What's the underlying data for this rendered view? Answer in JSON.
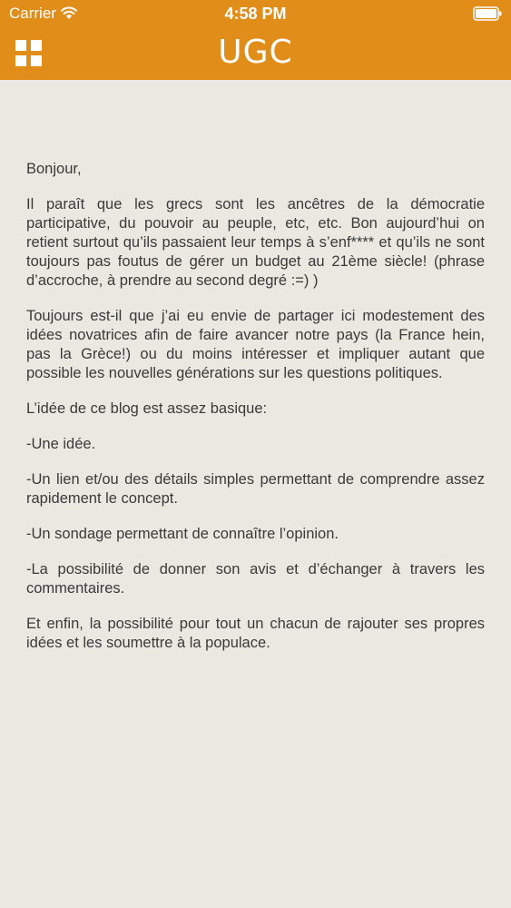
{
  "status_bar": {
    "carrier": "Carrier",
    "time": "4:58 PM",
    "wifi_icon": "wifi-icon",
    "battery_icon": "battery-icon"
  },
  "navbar": {
    "title": "UGC",
    "menu_icon": "grid-menu-icon",
    "color": "#e08d19"
  },
  "article": {
    "paragraphs": [
      "Bonjour,",
      "Il paraît que les grecs sont les ancêtres de la démocratie participative, du pouvoir au peuple, etc, etc. Bon aujourd’hui on retient surtout qu’ils passaient leur temps à s’enf**** et qu’ils ne sont toujours pas foutus de gérer un budget au 21ème siècle! (phrase d’accroche, à prendre au second degré :=) )",
      "Toujours est-il que j’ai eu envie de partager ici modestement des idées novatrices afin de faire avancer notre pays (la France hein, pas la Grèce!) ou du moins intéresser et impliquer autant que possible les nouvelles générations sur les questions politiques.",
      "L’idée de ce blog est assez basique:",
      "-Une idée.",
      "-Un lien et/ou des détails simples permettant de comprendre assez rapidement le concept.",
      "-Un sondage permettant de connaître l’opinion.",
      "-La possibilité de donner son avis et d’échanger à travers les commentaires.",
      "Et enfin, la possibilité pour tout un chacun de rajouter ses propres idées et les soumettre à la populace."
    ]
  },
  "colors": {
    "background": "#ebe7e1",
    "text": "#3a3a3a"
  }
}
